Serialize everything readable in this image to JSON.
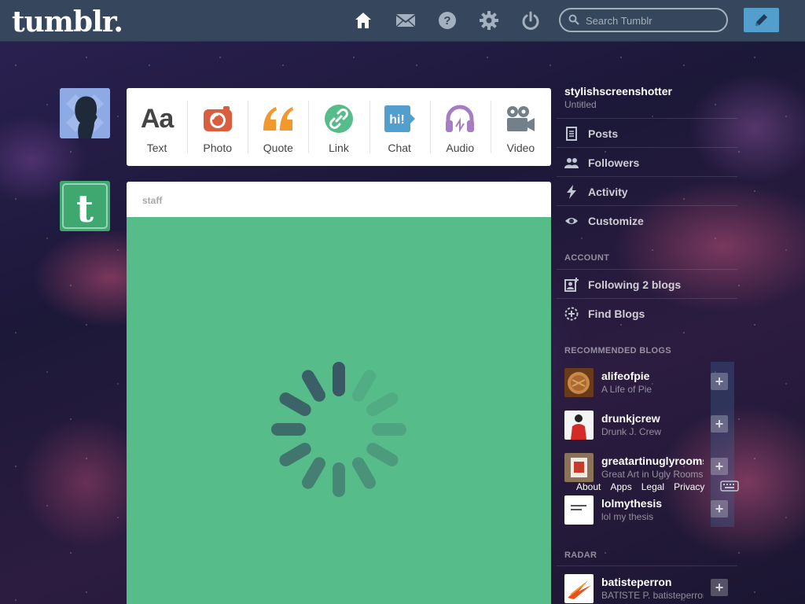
{
  "header": {
    "logo": "tumblr.",
    "search_placeholder": "Search Tumblr",
    "nav_icons": [
      "home-icon",
      "mail-icon",
      "help-icon",
      "gear-icon",
      "power-icon"
    ],
    "compose_icon": "pencil-icon"
  },
  "post_types": [
    {
      "label": "Text",
      "icon": "text-icon",
      "color": "#444444"
    },
    {
      "label": "Photo",
      "icon": "camera-icon",
      "color": "#d95e40"
    },
    {
      "label": "Quote",
      "icon": "quote-icon",
      "color": "#f2992e"
    },
    {
      "label": "Link",
      "icon": "link-icon",
      "color": "#56bc8a"
    },
    {
      "label": "Chat",
      "icon": "chat-icon",
      "color": "#529ecc"
    },
    {
      "label": "Audio",
      "icon": "headphones-icon",
      "color": "#a77dc2"
    },
    {
      "label": "Video",
      "icon": "video-camera-icon",
      "color": "#748089"
    }
  ],
  "post": {
    "author": "staff",
    "background": "#56bc8a"
  },
  "sidebar": {
    "blog_name": "stylishscreenshotter",
    "blog_title": "Untitled",
    "menu": [
      {
        "label": "Posts",
        "icon": "posts-icon"
      },
      {
        "label": "Followers",
        "icon": "followers-icon"
      },
      {
        "label": "Activity",
        "icon": "activity-icon"
      },
      {
        "label": "Customize",
        "icon": "eye-icon"
      }
    ],
    "account_heading": "ACCOUNT",
    "account": [
      {
        "label": "Following 2 blogs",
        "icon": "following-icon"
      },
      {
        "label": "Find Blogs",
        "icon": "compass-icon"
      }
    ],
    "recommended_heading": "RECOMMENDED BLOGS",
    "recommended": [
      {
        "name": "alifeofpie",
        "title": "A Life of Pie"
      },
      {
        "name": "drunkjcrew",
        "title": "Drunk J. Crew"
      },
      {
        "name": "greatartinuglyrooms",
        "title": "Great Art in Ugly Rooms"
      },
      {
        "name": "lolmythesis",
        "title": "lol my thesis"
      }
    ],
    "footer_links": [
      "About",
      "Apps",
      "Legal",
      "Privacy"
    ],
    "radar_heading": "RADAR",
    "radar": [
      {
        "name": "batisteperron",
        "title": "BATISTE P. batisteperron"
      }
    ]
  }
}
